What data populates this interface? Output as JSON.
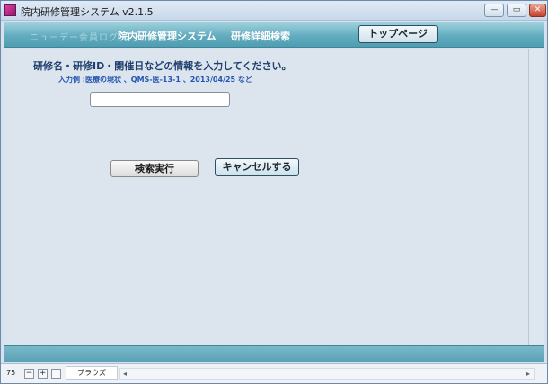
{
  "window": {
    "title": "院内研修管理システム v2.1.5",
    "minimize_glyph": "—",
    "restore_glyph": "▭",
    "close_glyph": "✕"
  },
  "header": {
    "faint_text": "ニューデー会員ログ",
    "app_title": "院内研修管理システム",
    "page_title": "研修詳細検索",
    "top_page_button": "トップページ"
  },
  "search": {
    "instruction": "研修名・研修ID・開催日などの情報を入力してください。",
    "example": "入力例 :医療の現状 、QMS-医-13-1 、2013/04/25 など",
    "input_value": "",
    "execute_button": "検索実行",
    "cancel_button": "キャンセルする"
  },
  "statusbar": {
    "zoom": "75",
    "minus_glyph": "−",
    "plus_glyph": "+",
    "mode": "ブラウズ",
    "left_arrow": "◂",
    "right_arrow": "▸"
  },
  "colors": {
    "header_band": "#63acbf",
    "content_bg": "#dce5ee",
    "heading_text": "#1f3f6f",
    "example_text": "#2454b0"
  }
}
